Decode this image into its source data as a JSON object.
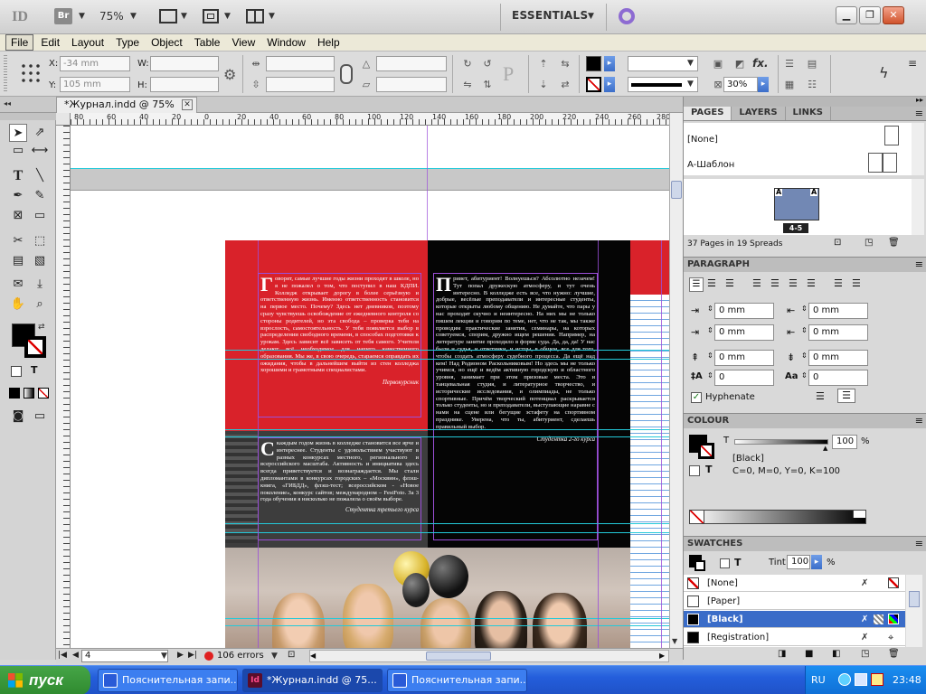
{
  "titlebar": {
    "id_logo": "ID",
    "br_logo": "Br",
    "zoom": "75%",
    "workspace": "ESSENTIALS"
  },
  "menu": [
    "File",
    "Edit",
    "Layout",
    "Type",
    "Object",
    "Table",
    "View",
    "Window",
    "Help"
  ],
  "control": {
    "x_label": "X:",
    "x_value": "-34 mm",
    "y_label": "Y:",
    "y_value": "105 mm",
    "w_label": "W:",
    "h_label": "H:",
    "opacity": "30%"
  },
  "document_tab": {
    "title": "*Журнал.indd @ 75%"
  },
  "ruler": {
    "h_ticks": [
      "80",
      "60",
      "40",
      "20",
      "0",
      "20",
      "40",
      "60",
      "80",
      "100",
      "120",
      "140",
      "160",
      "180",
      "200",
      "220",
      "240",
      "260",
      "280"
    ]
  },
  "page": {
    "col1_text": "оворят, самые лучшие годы жизни проходят в школе, но я не пожалел о том, что поступил в наш КДПИ. Колледж открывает дорогу в более серьёзную и ответственную жизнь. Именно ответственность становится на первое место. Почему? Здесь нет дневников, поэтому сразу чувствуешь освобождение от ежедневного контроля со стороны родителей, но эта свобода – проверка тебя на взрослость, самостоятельность. У тебя появляется выбор в распределении свободного времени, в способах подготовки к урокам. Здесь зависит всё зависеть от тебя самого. Учителя делают всё необходимое для нашего качественного образования. Мы же, в свою очередь, стараемся оправдать их ожидания, чтобы в дальнейшем выйти из стен колледжа хорошими и грамотными специалистами.",
    "col1_dropcap": "Г",
    "col1_sig": "Первокурсник",
    "col1b_dropcap": "С",
    "col1b_text": "каждым годом жизнь в колледже становится все ярче и интереснее. Студенты с удовольствием участвуют в разных конкурсах местного, регионального и всероссийского масштаба. Активность и инициатива здесь всегда приветствуется и вознаграждается. Мы стали дипломантами в конкурсах городских – «Москвин», флэш-книга, «ГИБДД», флэш-тест; всероссийском - «Новое поколение», конкурс сайтов; международном – FestFoto. За 3 года обучения я нисколько не пожалела о своём выборе.",
    "col1b_sig": "Студентка третьего курса",
    "col2_dropcap": "П",
    "col2_text": "ривет, абитуриент! Волнуешься? Абсолютно незачем! Тут попал дружескую атмосферу, и тут очень интересно. В колледже есть все, что нужно: лучшие, добрые, весёлые преподаватели и интересные студенты, которые открыты любому общению. Не думайте, что пары у нас проходят скучно и неинтересно. На них мы не только пишем лекции и говорим по теме, нет, что не так, мы также проводим практические занятия, семинары, на которых советуемся, спорим, дружно ищем решения. Например, на литературе занятие проходило в форме суда. Да, да, да! У нас были и судья, и ответчики, и истцы, в общем, все для того, чтобы создать атмосферу судебного процесса. Да ещё над кем! Над Родионом Раскольниковым! Но здесь мы не только учимся, но ещё и ведём активную городскую и областного уровня, занимает при этом призовые места. Это и танцевальная студия, и литературное творчество, и исторические исследования, и олимпиады, не только спортивные. Причём творческий потенциал раскрывается только студенты, но и преподаватели, выступающие наравне с нами на сцене или бегущие эстафету на спортивном празднике. Уверена, что ты, абитуриент, сделаешь правильный выбор.",
    "col2_sig": "Студентка 2-го курса"
  },
  "panels": {
    "pages_tabs": [
      "PAGES",
      "LAYERS",
      "LINKS"
    ],
    "master_none": "[None]",
    "master_a": "A-Шаблон",
    "spread_a_left": "A",
    "spread_a_right": "A",
    "spread_label": "4-5",
    "pages_summary": "37 Pages in 19 Spreads",
    "paragraph_title": "PARAGRAPH",
    "indent_values": [
      "0 mm",
      "0 mm",
      "0 mm",
      "0 mm",
      "0 mm",
      "0 mm",
      "0",
      "0"
    ],
    "hyphenate": "Hyphenate",
    "colour_title": "COLOUR",
    "colour_t": "T",
    "colour_value": "100",
    "colour_pct": "%",
    "colour_name": "[Black]",
    "colour_cmyk": "C=0, M=0, Y=0, K=100",
    "swatches_title": "SWATCHES",
    "tint_label": "Tint:",
    "tint_value": "100",
    "tint_pct": "%",
    "swatches": [
      "[None]",
      "[Paper]",
      "[Black]",
      "[Registration]"
    ]
  },
  "status": {
    "page": "4",
    "errors": "106 errors"
  },
  "taskbar": {
    "start": "пуск",
    "tasks": [
      "Пояснительная запи...",
      "*Журнал.indd @ 75...",
      "Пояснительная запи..."
    ],
    "lang": "RU",
    "time": "23:48"
  },
  "colors": {
    "accent_red": "#d9222a",
    "selection_blue": "#3a6cc8",
    "guide_cyan": "#23c9d9",
    "frame_purple": "#9b4fd8"
  }
}
